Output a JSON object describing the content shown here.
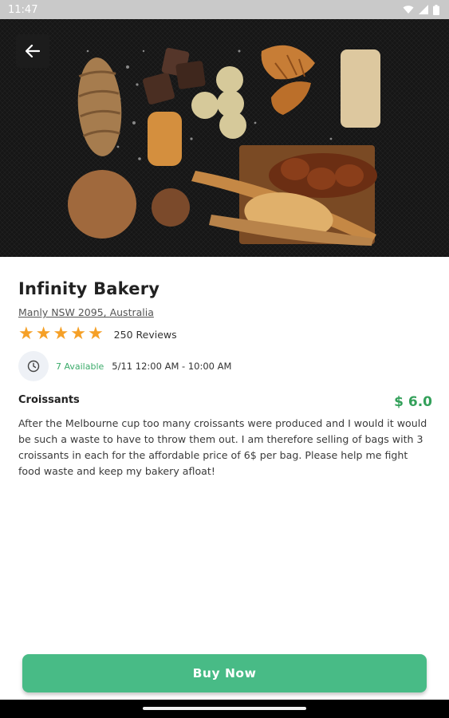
{
  "status_bar": {
    "time": "11:47",
    "icons": [
      "wifi-icon",
      "signal-icon",
      "battery-icon"
    ]
  },
  "hero": {
    "image": "bakery-bread-assortment",
    "back_icon": "arrow-left-icon"
  },
  "shop": {
    "name": "Infinity Bakery",
    "address": "Manly NSW 2095, Australia",
    "rating": 5,
    "reviews": "250 Reviews"
  },
  "availability": {
    "icon": "clock-icon",
    "available": "7 Available",
    "pickup_time": "5/11 12:00 AM - 10:00 AM"
  },
  "item": {
    "title": "Croissants",
    "price": "$ 6.0",
    "description": "After the Melbourne cup too many croissants were produced and I would it would be such a waste to have to throw them out. I am therefore selling of bags with 3 croissants in each for the affordable price of 6$ per bag. Please help me fight food waste and keep my bakery afloat!"
  },
  "actions": {
    "buy_label": "Buy  Now"
  },
  "colors": {
    "accent": "#48bb86",
    "price": "#33a05a",
    "star": "#f5a027",
    "available": "#3bab6a"
  }
}
